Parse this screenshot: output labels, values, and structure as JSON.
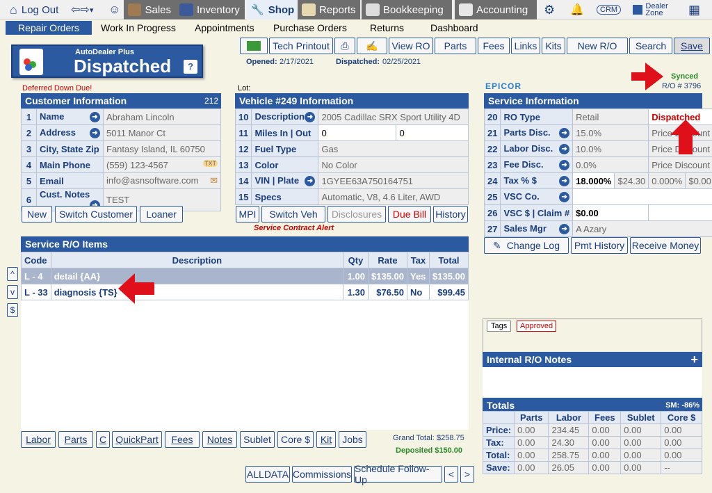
{
  "nav": {
    "logout": "Log Out",
    "tabs": [
      "Sales",
      "Inventory",
      "Shop",
      "Reports",
      "Bookkeeping",
      "Accounting"
    ],
    "crm": "CRM",
    "dealer_zone": "Dealer Zone"
  },
  "subnav": [
    "Repair Orders",
    "Work In Progress",
    "Appointments",
    "Purchase Orders",
    "Returns",
    "Dashboard"
  ],
  "logo": {
    "small": "AutoDealer Plus",
    "big": "Dispatched",
    "help": "?"
  },
  "toolbar": {
    "buttons": [
      "Tech Printout",
      "View RO",
      "Parts",
      "Fees",
      "Links",
      "Kits",
      "New R/O",
      "Search",
      "Save"
    ],
    "opened_label": "Opened:",
    "opened": "2/17/2021",
    "dispatched_label": "Dispatched:",
    "dispatched": "02/25/2021"
  },
  "sync": {
    "status": "Synced",
    "ro": "R/O # 3796",
    "brand": "EPICOR"
  },
  "customer": {
    "alert": "Deferred Down Due!",
    "title": "Customer Information",
    "count": "212",
    "rows": [
      {
        "n": "1",
        "label": "Name",
        "value": "Abraham Lincoln"
      },
      {
        "n": "2",
        "label": "Address",
        "value": "5011 Manor Ct"
      },
      {
        "n": "3",
        "label": "City, State Zip",
        "value": "Fantasy Island, IL 60750"
      },
      {
        "n": "4",
        "label": "Main Phone",
        "value": "(559) 123-4567"
      },
      {
        "n": "5",
        "label": "Email",
        "value": "info@asnsoftware.com"
      },
      {
        "n": "6",
        "label": "Cust. Notes",
        "value": "TEST"
      }
    ],
    "buttons": [
      "New",
      "Switch Customer",
      "Loaner"
    ]
  },
  "vehicle": {
    "lot": "Lot:",
    "title": "Vehicle #249 Information",
    "rows": [
      {
        "n": "10",
        "label": "Description",
        "value": "2005 Cadillac SRX Sport Utility 4D"
      },
      {
        "n": "11",
        "label": "Miles  In | Out",
        "value": "0",
        "value2": "0"
      },
      {
        "n": "12",
        "label": "Fuel Type",
        "value": "Gas"
      },
      {
        "n": "13",
        "label": "Color",
        "value": "No Color"
      },
      {
        "n": "14",
        "label": "VIN | Plate",
        "value": "1GYEE63A750164751"
      },
      {
        "n": "15",
        "label": "Specs",
        "value": "Automatic, V8, 4.6 Liter, AWD"
      }
    ],
    "buttons": [
      "MPI",
      "Switch Veh",
      "Disclosures",
      "Due Bill",
      "History"
    ],
    "alert": "Service Contract Alert"
  },
  "service": {
    "title": "Service Information",
    "rows": [
      {
        "n": "20",
        "label": "RO Type",
        "value": "Retail",
        "value2": "Dispatched"
      },
      {
        "n": "21",
        "label": "Parts Disc.",
        "value": "15.0%",
        "value2": "Price Discount"
      },
      {
        "n": "22",
        "label": "Labor Disc.",
        "value": "10.0%",
        "value2": "Price Discount"
      },
      {
        "n": "23",
        "label": "Fee Disc.",
        "value": "0.0%",
        "value2": "Price Discount"
      },
      {
        "n": "24",
        "label": "Tax % $",
        "value": "18.000%",
        "value2": "$24.30",
        "value3": "0.000%",
        "value4": "$0.00"
      },
      {
        "n": "25",
        "label": "VSC  Co.",
        "value": ""
      },
      {
        "n": "26",
        "label": "VSC $ | Claim #",
        "value": "$0.00"
      },
      {
        "n": "27",
        "label": "Sales Mgr",
        "value": "A Azary"
      }
    ],
    "buttons": [
      "Change Log",
      "Pmt History",
      "Receive Money"
    ]
  },
  "items": {
    "title": "Service R/O Items",
    "headers": [
      "Code",
      "Description",
      "Qty",
      "Rate",
      "Tax",
      "Total"
    ],
    "rows": [
      {
        "code": "L - 4",
        "desc": "detail {AA}",
        "qty": "1.00",
        "rate": "$135.00",
        "tax": "Yes",
        "total": "$135.00"
      },
      {
        "code": "L - 33",
        "desc": "diagnosis {TS}",
        "qty": "1.30",
        "rate": "$76.50",
        "tax": "No",
        "total": "$99.45"
      }
    ],
    "side": [
      "^",
      "v",
      "$"
    ],
    "buttons": [
      "Labor",
      "Parts",
      "C",
      "QuickPart",
      "Fees",
      "Notes",
      "Sublet",
      "Core $",
      "Kit",
      "Jobs"
    ],
    "grand_total_label": "Grand Total:",
    "grand_total": "$258.75",
    "deposited": "Deposited $150.00"
  },
  "bottom_buttons": [
    "ALLDATA",
    "Commissions",
    "Schedule Follow-Up",
    "<",
    ">"
  ],
  "tags": {
    "label": "Tags",
    "approved": "Approved"
  },
  "notes": {
    "title": "Internal R/O Notes",
    "plus": "+"
  },
  "totals": {
    "title": "Totals",
    "sm": "SM: -86%",
    "headers": [
      "",
      "Parts",
      "Labor",
      "Fees",
      "Sublet",
      "Core $"
    ],
    "rows": [
      [
        "Price:",
        "0.00",
        "234.45",
        "0.00",
        "0.00",
        "0.00"
      ],
      [
        "Tax:",
        "0.00",
        "24.30",
        "0.00",
        "0.00",
        "0.00"
      ],
      [
        "Total:",
        "0.00",
        "258.75",
        "0.00",
        "0.00",
        "0.00"
      ],
      [
        "Save:",
        "0.00",
        "26.05",
        "0.00",
        "0.00",
        "--"
      ]
    ]
  }
}
